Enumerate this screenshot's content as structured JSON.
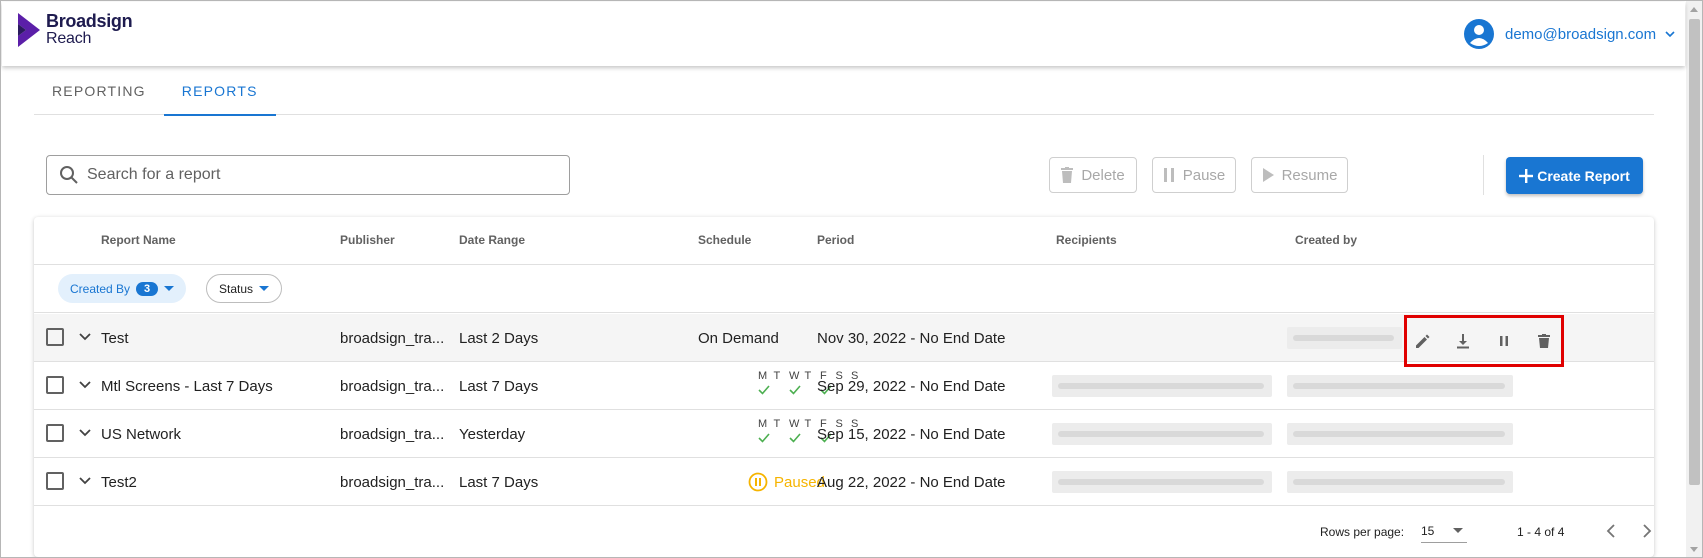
{
  "brand": {
    "name_line1": "Broadsign",
    "name_line2": "Reach",
    "accent": "#5b1fa8"
  },
  "user": {
    "email": "demo@broadsign.com"
  },
  "tabs": [
    {
      "label": "REPORTING",
      "active": false
    },
    {
      "label": "REPORTS",
      "active": true
    }
  ],
  "toolbar": {
    "search_placeholder": "Search for a report",
    "delete_label": "Delete",
    "pause_label": "Pause",
    "resume_label": "Resume",
    "create_label": "Create Report"
  },
  "table": {
    "columns": [
      "Report Name",
      "Publisher",
      "Date Range",
      "Schedule",
      "Period",
      "Recipients",
      "Created by"
    ],
    "filters": {
      "created_by_label": "Created By",
      "created_by_count": "3",
      "status_label": "Status"
    },
    "weekdays": [
      "M",
      "T",
      "W",
      "T",
      "F",
      "S",
      "S"
    ],
    "rows": [
      {
        "name": "Test",
        "publisher": "broadsign_tra...",
        "date_range": "Last 2 Days",
        "schedule": "On Demand",
        "period": "Nov 30, 2022 - No End Date"
      },
      {
        "name": "Mtl Screens - Last 7 Days",
        "publisher": "broadsign_tra...",
        "date_range": "Last 7 Days",
        "schedule": "M T W T F S S",
        "period": "Sep 29, 2022 - No End Date"
      },
      {
        "name": "US Network",
        "publisher": "broadsign_tra...",
        "date_range": "Yesterday",
        "schedule": "M T W T F S S",
        "period": "Sep 15, 2022 - No End Date"
      },
      {
        "name": "Test2",
        "publisher": "broadsign_tra...",
        "date_range": "Last 7 Days",
        "schedule": "Paused",
        "period": "Aug 22, 2022 - No End Date"
      }
    ]
  },
  "pagination": {
    "rows_per_page_label": "Rows per page:",
    "rows_per_page": "15",
    "range": "1 - 4 of 4"
  },
  "colors": {
    "primary": "#1976d2",
    "paused": "#f6b400",
    "check": "#4caf50",
    "highlight": "#e00000"
  }
}
